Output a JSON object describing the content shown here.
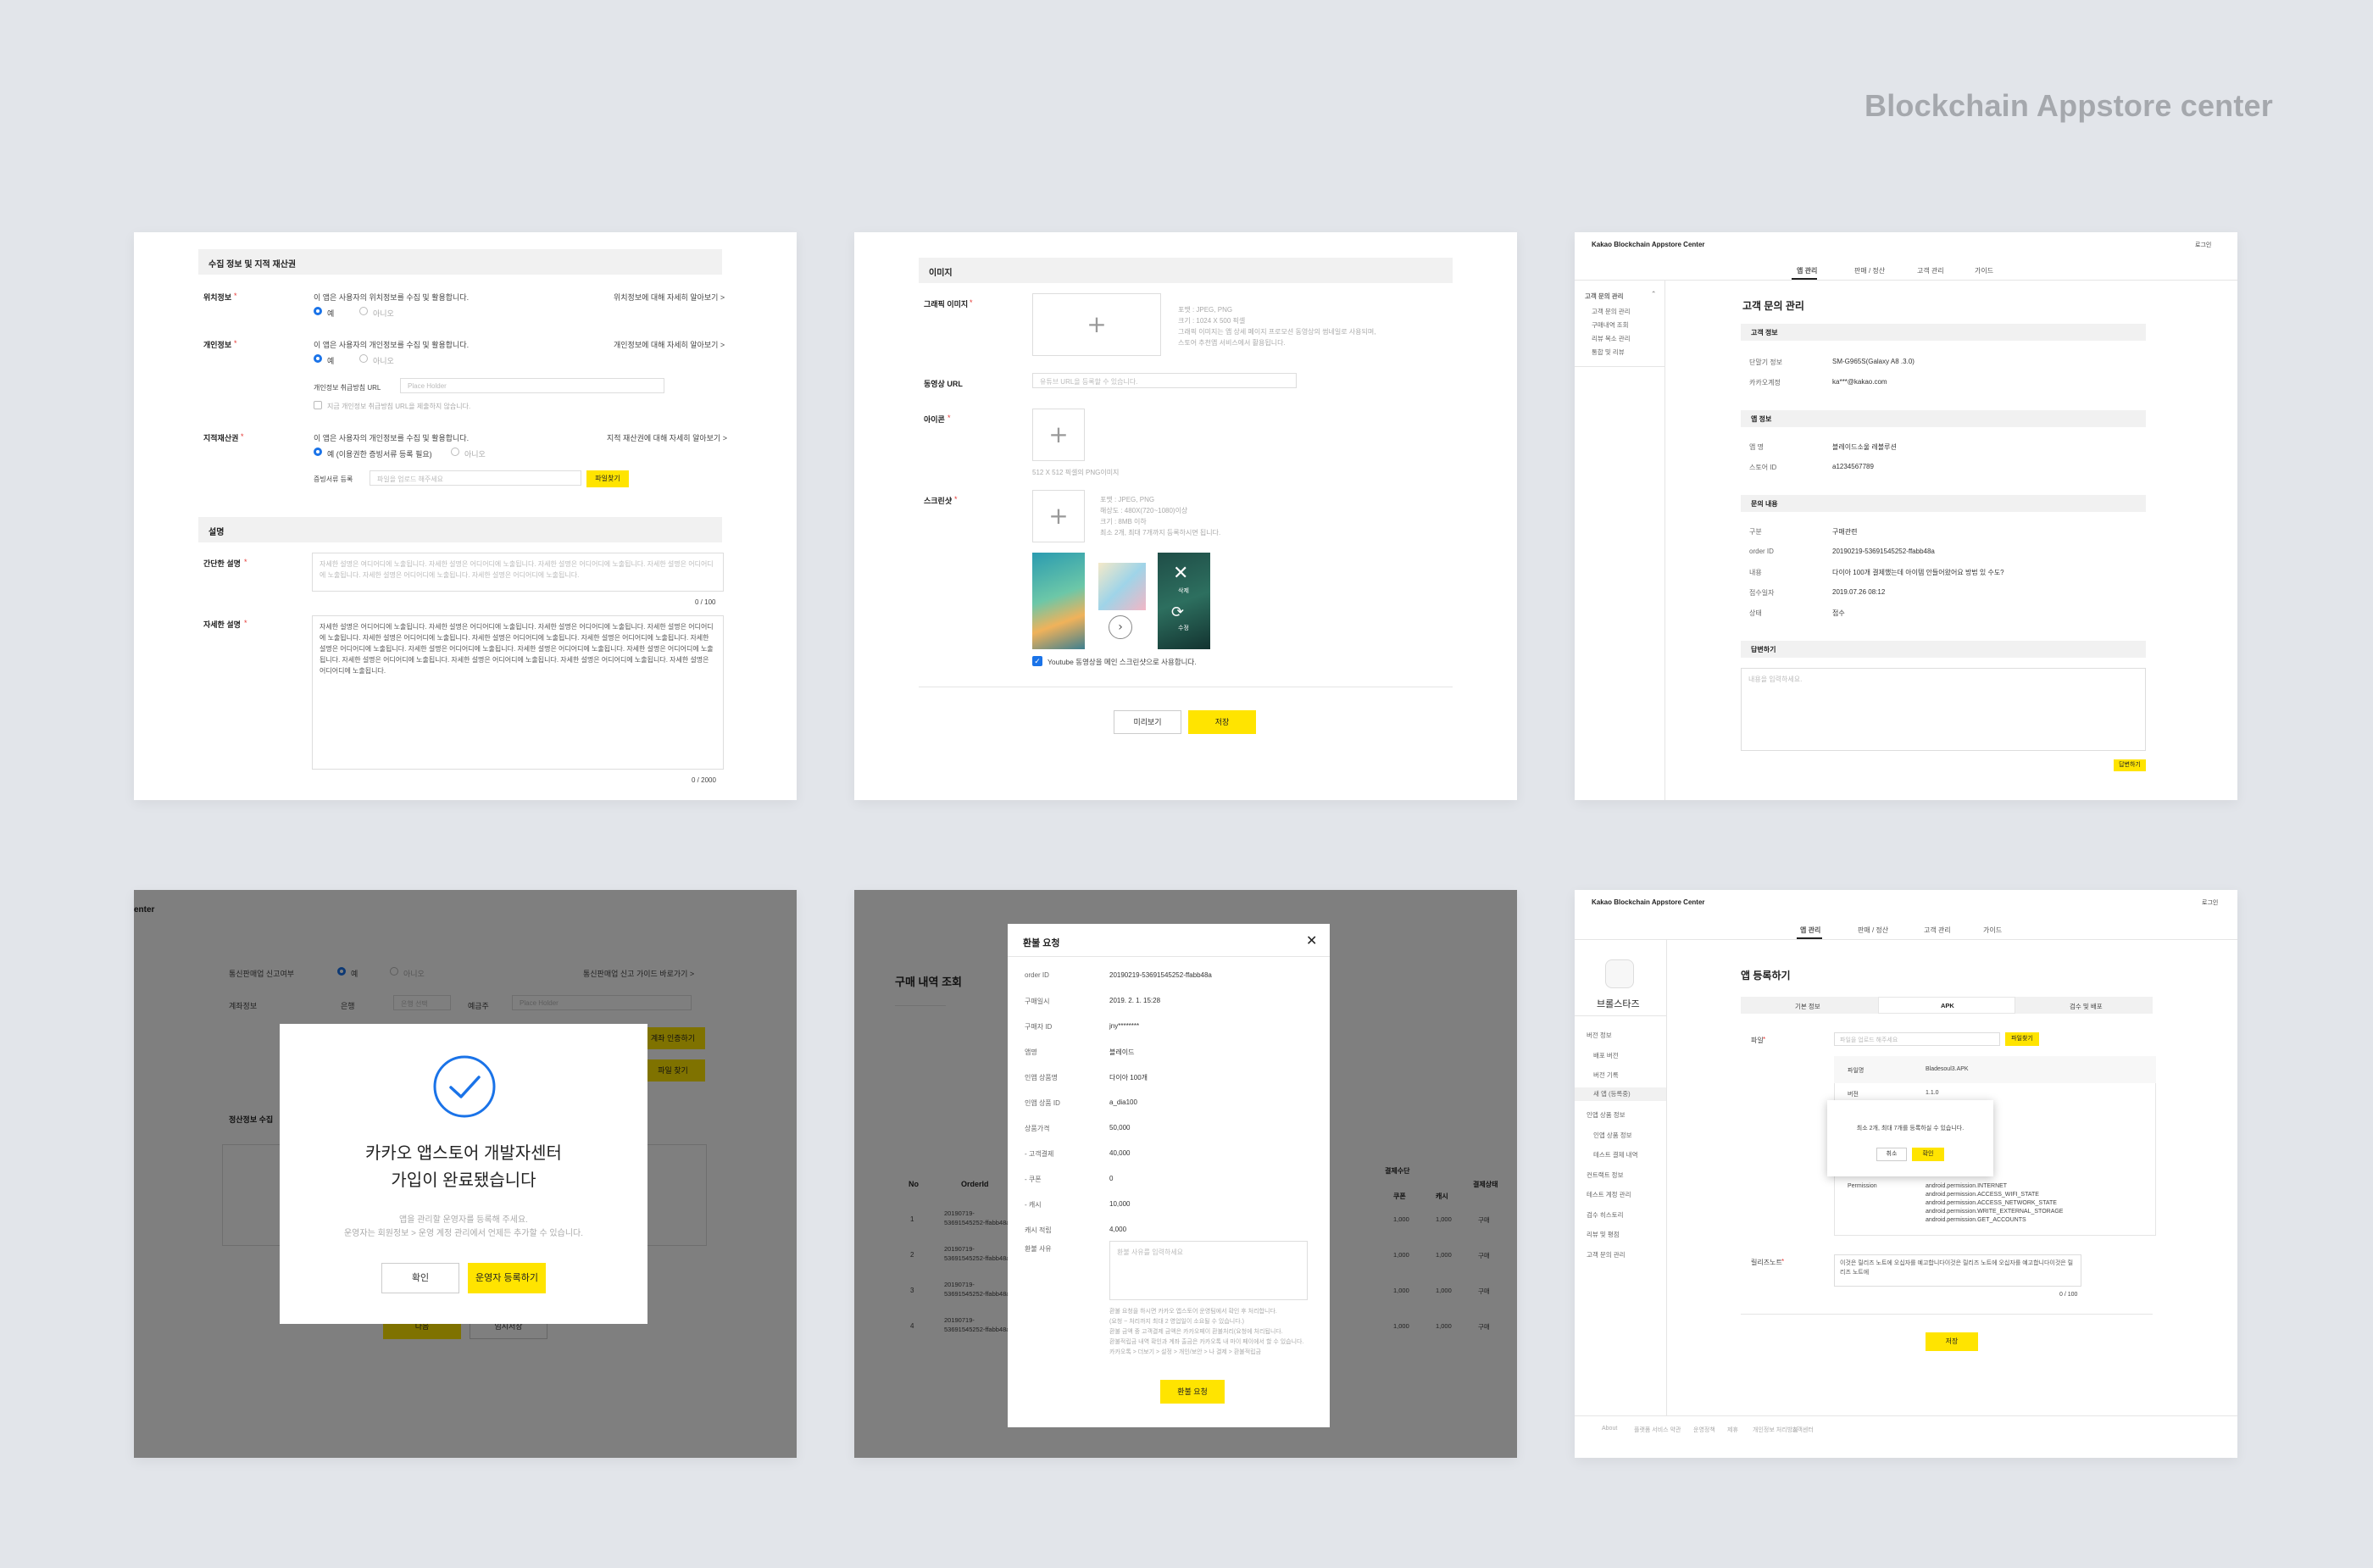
{
  "brand": "Blockchain Appstore center",
  "card1": {
    "section1": "수집 정보 및 지적 재산권",
    "loc_label": "위치정보",
    "loc_desc": "이 앱은 사용자의 위치정보를 수집 및 활용합니다.",
    "loc_link": "위치정보에 대해 자세히 알아보기 >",
    "yes": "예",
    "no": "아니오",
    "personal_label": "개인정보",
    "personal_desc": "이 앱은 사용자의 개인정보를 수집 및 활용합니다.",
    "personal_link": "개인정보에 대해 자세히 알아보기 >",
    "policy_url_label": "개인정보 취급방침 URL",
    "policy_url_placeholder": "Place Holder",
    "policy_check": "지금 개인정보 취급방침 URL을 제출하지 않습니다.",
    "ip_label": "지적재산권",
    "ip_desc": "이 앱은 사용자의 개인정보를 수집 및 활용합니다.",
    "ip_link": "지적 재산권에 대해 자세히 알아보기 >",
    "ip_yes": "예 (이용권한 증빙서류 등록 필요)",
    "doc_label": "증빙서류 등록",
    "doc_placeholder": "파일을 업로드 해주세요",
    "find_file": "파일찾기",
    "section2": "설명",
    "short_label": "간단한 설명",
    "short_placeholder": "자세한 설명은 여디어디에 노출됩니다. 자세한 설명은 어디어디에 노출됩니다. 자세한 설명은 어디어디에 노출됩니다. 자세한 설명은 어디어디에 노출됩니다. 자세한 설명은 어디어디에 노출됩니다. 자세한 설명은 어디어디에 노출됩니다.",
    "short_count": "0 / 100",
    "long_label": "자세한 설명",
    "long_text": "자세한 설명은 어디어디에 노출됩니다. 자세한 설명은 어디어디에 노출됩니다. 자세한 설명은 어디어디에 노출됩니다. 자세한 설명은 어디어디에 노출됩니다. 자세한 설명은 어디어디에 노출됩니다. 자세한 설명은 어디어디에 노출됩니다. 자세한 설명은 어디어디에 노출됩니다. 자세한 설명은 어디어디에 노출됩니다. 자세한 설명은 어디어디에 노출됩니다. 자세한 설명은 어디어디에 노출됩니다. 자세한 설명은 어디어디에 노출됩니다. 자세한 설명은 어디어디에 노출됩니다. 자세한 설명은 어디어디에 노출됩니다. 자세한 설명은 어디어디에 노출됩니다. 자세한 설명은 어디어디에 노출됩니다.",
    "long_count": "0 / 2000"
  },
  "card2": {
    "section": "이미지",
    "graphic_label": "그래픽 이미지",
    "graphic_desc": [
      "포맷 : JPEG, PNG",
      "크기 : 1024 X 500 픽셀",
      "그래픽 이미지는 앱 상세 페이지 프로모션 동영상의 썸네일로 사용되며,",
      "스토어 추천앱 서비스에서 활용됩니다."
    ],
    "video_label": "동영상 URL",
    "video_placeholder": "유튜브 URL을 등록할 수 있습니다.",
    "icon_label": "아이콘",
    "icon_desc": "512 X 512 픽셀의 PNG이미지",
    "shot_label": "스크린샷",
    "shot_desc": [
      "포맷 : JPEG, PNG",
      "해상도 : 480X(720~1080)이상",
      "크기 : 8MB 이하",
      "최소 2개, 최대 7개까지 등록하시면 됩니다."
    ],
    "delete_label": "삭제",
    "edit_label": "수정",
    "youtube_check": "Youtube 동영상을 메인 스크린샷으로 사용합니다.",
    "preview_btn": "미리보기",
    "save_btn": "저장"
  },
  "card3": {
    "app_title": "Kakao Blockchain Appstore Center",
    "logout": "로그인",
    "tabs": [
      "앱 관리",
      "판매 / 정산",
      "고객 관리",
      "가이드"
    ],
    "side_group": "고객 문의 관리",
    "side_items": [
      "고객 문의 관리",
      "구매내역 조회",
      "리뷰 목소 관리",
      "통합 및 리뷰"
    ],
    "page_title": "고객 문의 관리",
    "sec_customer": "고객 정보",
    "device_k": "단말기 정보",
    "device_v": "SM-G965S(Galaxy A8 .3.0)",
    "account_k": "카카오계정",
    "account_v": "ka***@kakao.com",
    "sec_app": "앱 정보",
    "appname_k": "앱 명",
    "appname_v": "블레이드소울 레볼루션",
    "storeid_k": "스토어 ID",
    "storeid_v": "a1234567789",
    "sec_inquiry": "문의 내용",
    "type_k": "구분",
    "type_v": "구매관련",
    "order_k": "order ID",
    "order_v": "20190219-53691545252-ffabb48a",
    "content_k": "내용",
    "content_v": "다이아 100개 결제했는데 아이템 안들어왔어요 방법 있 수도?",
    "date_k": "접수일자",
    "date_v": "2019.07.26  08:12",
    "status_k": "상태",
    "status_v": "접수",
    "sec_answer": "답변하기",
    "answer_placeholder": "내용을 입력하세요.",
    "answer_btn": "답변하기"
  },
  "card4": {
    "header": "enter",
    "row1_label": "통신판매업 신고여부",
    "row1_yes": "예",
    "row1_no": "아니오",
    "row1_link": "통신판매업 신고 가이드 바로가기 >",
    "row2_label": "계좌정보",
    "row2_bank": "은행",
    "row2_select": "은행 선택",
    "row2_holder": "예금주",
    "row2_placeholder": "Place Holder",
    "btn_a": "계좌 인증하기",
    "btn_b": "파일 찾기",
    "settle_title": "정산정보 수집",
    "next_btn": "다음",
    "temp_btn": "임시저장",
    "modal_title_1": "카카오 앱스토어 개발자센터",
    "modal_title_2": "가입이 완료됐습니다",
    "modal_desc_1": "앱을 관리할 운영자를 등록해 주세요.",
    "modal_desc_2": "운영자는 회원정보 > 운영 계정 관리에서 언제든 추가할 수 있습니다.",
    "modal_ok": "확인",
    "modal_register": "운영자 등록하기"
  },
  "card5": {
    "bg_title": "구매 내역 조회",
    "bg_head_no": "No",
    "bg_head_order": "OrderId",
    "bg_head_method": "결제수단",
    "bg_head_coupon": "쿠폰",
    "bg_head_cash": "캐시",
    "bg_head_status": "결제상태",
    "bg_rows": [
      {
        "no": "1",
        "order": "20190719-53691545252-ffabb48a",
        "coupon": "1,000",
        "cash": "1,000",
        "status": "구매"
      },
      {
        "no": "2",
        "order": "20190719-53691545252-ffabb48a",
        "coupon": "1,000",
        "cash": "1,000",
        "status": "구매"
      },
      {
        "no": "3",
        "order": "20190719-53691545252-ffabb48a",
        "coupon": "1,000",
        "cash": "1,000",
        "status": "구매"
      },
      {
        "no": "4",
        "order": "20190719-53691545252-ffabb48a",
        "coupon": "1,000",
        "cash": "1,000",
        "status": "구매"
      }
    ],
    "modal_title": "환불 요청",
    "fields": [
      {
        "k": "order ID",
        "v": "20190219-53691545252-ffabb48a"
      },
      {
        "k": "구매일시",
        "v": "2019. 2. 1.  15:28"
      },
      {
        "k": "구매자 ID",
        "v": "jny********"
      },
      {
        "k": "앱명",
        "v": "블레이드"
      },
      {
        "k": "인앱 상품명",
        "v": "다이아 100개"
      },
      {
        "k": "인앱 상품 ID",
        "v": "a_dia100"
      },
      {
        "k": "상품가격",
        "v": "50,000"
      },
      {
        "k": "- 고객결제",
        "v": "40,000"
      },
      {
        "k": "- 쿠폰",
        "v": "0"
      },
      {
        "k": "- 캐시",
        "v": "10,000"
      },
      {
        "k": "캐시 적립",
        "v": "4,000"
      }
    ],
    "reason_label": "환불 사유",
    "reason_placeholder": "환불 사유를 입력하세요",
    "notes": [
      "환불 요청을 하시면 카카오 앱스토어 운영팀에서 확인 후 처리합니다.",
      "(요청 ~ 처리까지 최대 2 영업일이 소요될 수 있습니다.)",
      "환불 금액 중 고객결제 금액은 카카오페이 환불처리(요청에 처리됩니다.",
      "환불적립금 내역 확인과 계좌 출금은 카카오톡 내 마이 페이에서 할 수 있습니다.",
      "카카오톡 > 더보기 > 설정 > 개인/보안 > 나 결제 > 환불적립금"
    ],
    "submit_btn": "환불 요청"
  },
  "card6": {
    "app_title": "Kakao Blockchain Appstore Center",
    "logout": "로그인",
    "tabs": [
      "앱 관리",
      "판매 / 정산",
      "고객 관리",
      "가이드"
    ],
    "app_name": "브롤스타즈",
    "side_items": [
      "버전 정보",
      "배포 버전",
      "버전 기록",
      "새 앱 (등록중)",
      "인앱 상품 정보",
      "인앱 상품 정보",
      "테스트 결제 내역",
      "컨트랙트 정보",
      "테스트 계정 관리",
      "검수 히스토리",
      "리뷰 및 평점",
      "고객 문의 관리"
    ],
    "page_title": "앱 등록하기",
    "step_tabs": [
      "기본 정보",
      "APK",
      "검수 및 배포"
    ],
    "file_label": "파일",
    "file_placeholder": "파일을 업로드 해주세요",
    "find_file": "파일찾기",
    "filename_k": "파일명",
    "filename_v": "Bladesoul3.APK",
    "version_k": "버전",
    "version_v": "1.1.0",
    "perm_k": "Permission",
    "perms": [
      "android.permission.INTERNET",
      "android.permission.ACCESS_WIFI_STATE",
      "android.permission.ACCESS_NETWORK_STATE",
      "android.permission.WRITE_EXTERNAL_STORAGE",
      "android.permission.GET_ACCOUNTS"
    ],
    "popup_text": "최소 2개, 최대 7개를 등록하실 수 있습니다.",
    "popup_cancel": "취소",
    "popup_ok": "확인",
    "note_label": "릴리즈노트",
    "note_text": "이것은 릴리즈 노트에 오십자를 예고합니다이것은 릴리즈 노트에 오십자를 예고합니다이것은 릴리즈 노트에",
    "note_count": "0 / 100",
    "save_btn": "저장",
    "footer": [
      "About",
      "플랫폼 서비스 약관",
      "운영정책",
      "제휴",
      "개인정보 처리방침",
      "고객센터"
    ]
  },
  "colors": {
    "accent": "#ffe400",
    "radio": "#1a73e8",
    "background": "#e2e5ea"
  }
}
